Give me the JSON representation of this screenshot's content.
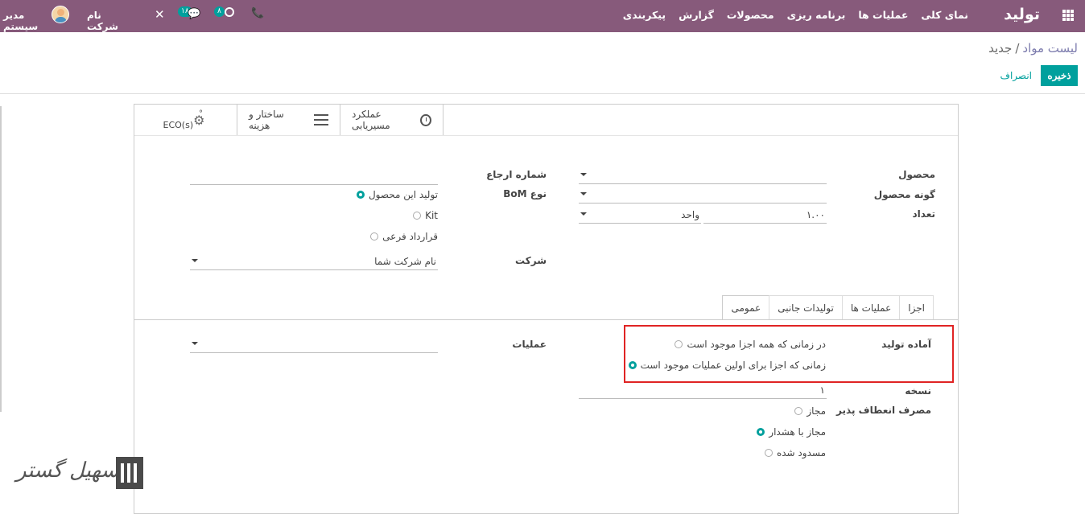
{
  "navbar": {
    "brand": "تولید",
    "menu": [
      "نمای کلی",
      "عملیات ها",
      "برنامه ریزی",
      "محصولات",
      "گزارش",
      "پیکربندی"
    ],
    "user": "مدیر سیستم",
    "company": "نام شرکت شما",
    "activity_count": "۸",
    "message_count": "۱۸",
    "accent_color": "#875a7b"
  },
  "breadcrumb": {
    "parent": "لیست مواد",
    "separator": "/",
    "current": "جدید"
  },
  "actions": {
    "save": "ذخیره",
    "discard": "انصراف"
  },
  "stat_buttons": {
    "eco": "ECO(s)",
    "eco_count": "°",
    "structure": "ساختار و هزینه",
    "routing": "عملکرد مسیریابی"
  },
  "form": {
    "product_label": "محصول",
    "variant_label": "گونه محصول",
    "quantity_label": "تعداد",
    "quantity_value": "۱.۰۰",
    "uom_value": "واحد",
    "reference_label": "شماره ارجاع",
    "bom_type_label": "نوع BoM",
    "bom_type_options": [
      "تولید این محصول",
      "Kit",
      "قرارداد فرعی"
    ],
    "company_label": "شرکت",
    "company_value": "نام شرکت شما"
  },
  "tabs": [
    "اجزا",
    "عملیات ها",
    "تولیدات جانبی",
    "عمومی"
  ],
  "general": {
    "ready_label": "آماده تولید",
    "ready_options": [
      "در زمانی که همه اجزا موجود است",
      "زمانی که اجزا برای اولین عملیات موجود است"
    ],
    "version_label": "نسخه",
    "version_value": "۱",
    "flexible_label": "مصرف انعطاف پذیر",
    "flexible_options": [
      "مجاز",
      "مجاز با هشدار",
      "مسدود شده"
    ],
    "operations_label": "عملیات"
  },
  "watermark": {
    "text": "تسهیل گستر"
  }
}
